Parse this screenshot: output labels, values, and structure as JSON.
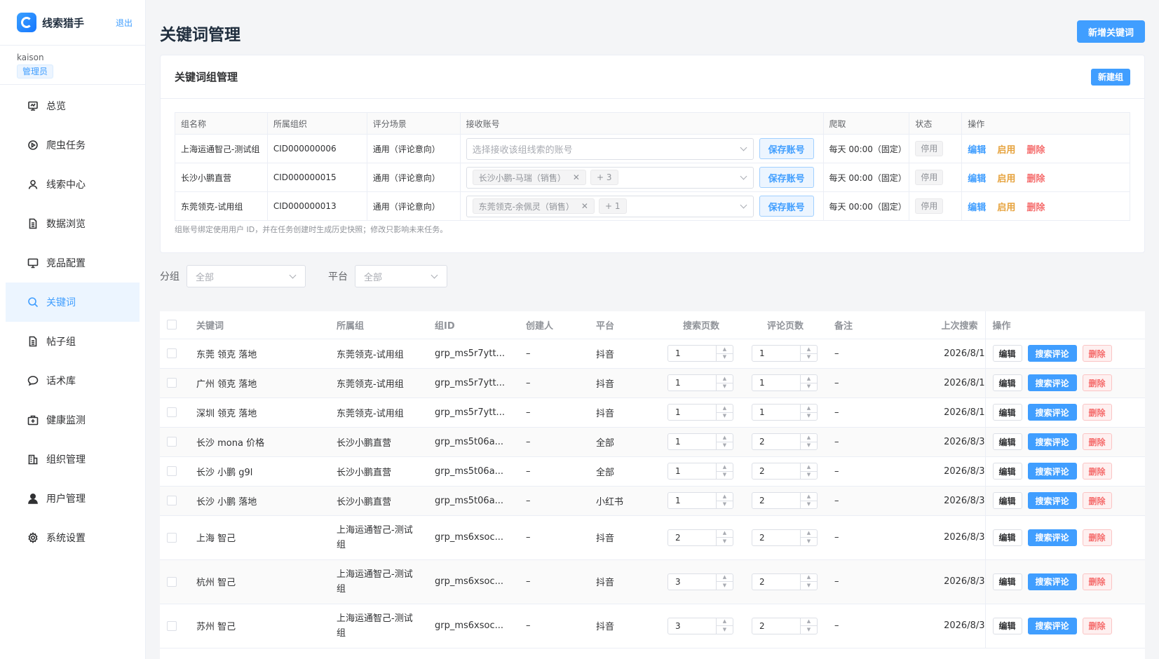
{
  "app": {
    "name": "线索猎手",
    "logout": "退出"
  },
  "user": {
    "name": "kaison",
    "role": "管理员"
  },
  "nav": [
    {
      "label": "总览",
      "icon": "dashboard-icon"
    },
    {
      "label": "爬虫任务",
      "icon": "play-circle-icon"
    },
    {
      "label": "线索中心",
      "icon": "user-icon"
    },
    {
      "label": "数据浏览",
      "icon": "document-icon"
    },
    {
      "label": "竞品配置",
      "icon": "monitor-icon"
    },
    {
      "label": "关键词",
      "icon": "search-icon",
      "active": true
    },
    {
      "label": "帖子组",
      "icon": "document-icon"
    },
    {
      "label": "话术库",
      "icon": "chat-icon"
    },
    {
      "label": "健康监测",
      "icon": "medkit-icon"
    },
    {
      "label": "组织管理",
      "icon": "building-icon"
    },
    {
      "label": "用户管理",
      "icon": "user-solid-icon"
    },
    {
      "label": "系统设置",
      "icon": "gear-icon"
    }
  ],
  "page": {
    "title": "关键词管理",
    "add_keyword": "新增关键词"
  },
  "group_card": {
    "title": "关键词组管理",
    "new_group": "新建组",
    "columns": [
      "组名称",
      "所属组织",
      "评分场景",
      "接收账号",
      "爬取",
      "状态",
      "操作"
    ],
    "rows": [
      {
        "name": "上海运通智己-测试组",
        "org": "CID000000006",
        "scene": "通用（评论意向）",
        "placeholder": "选择接收该组线索的账号",
        "tags": [],
        "more": "",
        "save": "保存账号",
        "crawl": "每天 00:00（固定）",
        "status": "停用",
        "edit": "编辑",
        "enable": "启用",
        "delete": "删除"
      },
      {
        "name": "长沙小鹏直营",
        "org": "CID000000015",
        "scene": "通用（评论意向）",
        "placeholder": "",
        "tags": [
          "长沙小鹏-马瑞（销售）"
        ],
        "more": "+ 3",
        "save": "保存账号",
        "crawl": "每天 00:00（固定）",
        "status": "停用",
        "edit": "编辑",
        "enable": "启用",
        "delete": "删除"
      },
      {
        "name": "东莞领克-试用组",
        "org": "CID000000013",
        "scene": "通用（评论意向）",
        "placeholder": "",
        "tags": [
          "东莞领克-余佩灵（销售）"
        ],
        "more": "+ 1",
        "save": "保存账号",
        "crawl": "每天 00:00（固定）",
        "status": "停用",
        "edit": "编辑",
        "enable": "启用",
        "delete": "删除"
      }
    ],
    "note": "组账号绑定使用用户 ID，并在任务创建时生成历史快照；修改只影响未来任务。"
  },
  "filters": {
    "group_label": "分组",
    "group_value": "全部",
    "platform_label": "平台",
    "platform_value": "全部"
  },
  "keywords": {
    "columns": [
      "关键词",
      "所属组",
      "组ID",
      "创建人",
      "平台",
      "搜索页数",
      "评论页数",
      "备注",
      "上次搜索",
      "操作"
    ],
    "rows": [
      {
        "kw": "东莞 领克 落地",
        "group": "东莞领克-试用组",
        "gid": "grp_ms5r7ytt...",
        "creator": "–",
        "platform": "抖音",
        "search_pages": "1",
        "comment_pages": "1",
        "note": "–",
        "last": "2026/8/1",
        "tall": false
      },
      {
        "kw": "广州 领克 落地",
        "group": "东莞领克-试用组",
        "gid": "grp_ms5r7ytt...",
        "creator": "–",
        "platform": "抖音",
        "search_pages": "1",
        "comment_pages": "1",
        "note": "–",
        "last": "2026/8/1",
        "tall": false
      },
      {
        "kw": "深圳 领克 落地",
        "group": "东莞领克-试用组",
        "gid": "grp_ms5r7ytt...",
        "creator": "–",
        "platform": "抖音",
        "search_pages": "1",
        "comment_pages": "1",
        "note": "–",
        "last": "2026/8/1",
        "tall": false
      },
      {
        "kw": "长沙 mona 价格",
        "group": "长沙小鹏直营",
        "gid": "grp_ms5t06a...",
        "creator": "–",
        "platform": "全部",
        "search_pages": "1",
        "comment_pages": "2",
        "note": "–",
        "last": "2026/8/3",
        "tall": false
      },
      {
        "kw": "长沙 小鹏 g9l",
        "group": "长沙小鹏直营",
        "gid": "grp_ms5t06a...",
        "creator": "–",
        "platform": "全部",
        "search_pages": "1",
        "comment_pages": "2",
        "note": "–",
        "last": "2026/8/3",
        "tall": false
      },
      {
        "kw": "长沙 小鹏 落地",
        "group": "长沙小鹏直营",
        "gid": "grp_ms5t06a...",
        "creator": "–",
        "platform": "小红书",
        "search_pages": "1",
        "comment_pages": "2",
        "note": "–",
        "last": "2026/8/3",
        "tall": false
      },
      {
        "kw": "上海 智己",
        "group": "上海运通智己-测试组",
        "gid": "grp_ms6xsoc...",
        "creator": "–",
        "platform": "抖音",
        "search_pages": "2",
        "comment_pages": "2",
        "note": "–",
        "last": "2026/8/3",
        "tall": true
      },
      {
        "kw": "杭州 智己",
        "group": "上海运通智己-测试组",
        "gid": "grp_ms6xsoc...",
        "creator": "–",
        "platform": "抖音",
        "search_pages": "3",
        "comment_pages": "2",
        "note": "–",
        "last": "2026/8/3",
        "tall": true
      },
      {
        "kw": "苏州 智己",
        "group": "上海运通智己-测试组",
        "gid": "grp_ms6xsoc...",
        "creator": "–",
        "platform": "抖音",
        "search_pages": "3",
        "comment_pages": "2",
        "note": "–",
        "last": "2026/8/3",
        "tall": true
      }
    ],
    "actions": {
      "edit": "编辑",
      "search": "搜索评论",
      "delete": "删除"
    }
  },
  "colors": {
    "primary": "#409eff",
    "warning": "#e6a23c",
    "danger": "#f56c6c"
  }
}
